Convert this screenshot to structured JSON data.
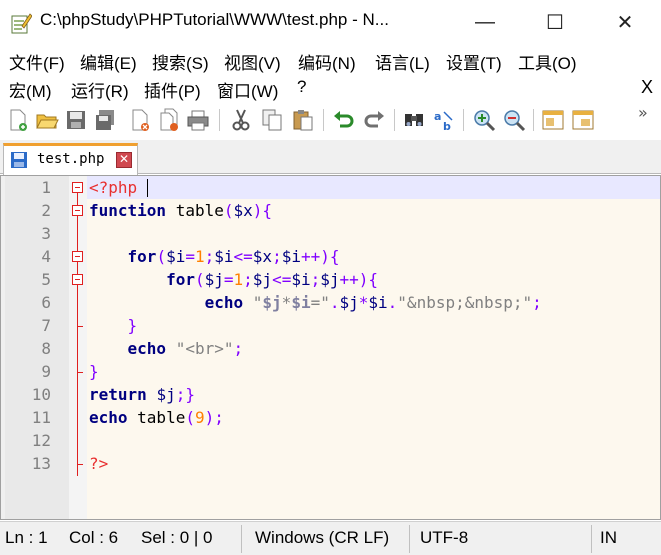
{
  "window": {
    "title": "C:\\phpStudy\\PHPTutorial\\WWW\\test.php - N...",
    "minimize": "—",
    "maximize": "☐",
    "close": "✕"
  },
  "menu": {
    "row1": [
      "文件(F)",
      "编辑(E)",
      "搜索(S)",
      "视图(V)",
      "编码(N)",
      "语言(L)",
      "设置(T)",
      "工具(O)"
    ],
    "row2": [
      "宏(M)",
      "运行(R)",
      "插件(P)",
      "窗口(W)",
      "?"
    ],
    "close_label": "X"
  },
  "toolbar": {
    "icons": [
      "new-file-icon",
      "open-file-icon",
      "save-icon",
      "save-all-icon",
      "close-icon",
      "close-all-icon",
      "print-icon",
      "cut-icon",
      "copy-icon",
      "paste-icon",
      "undo-icon",
      "redo-icon",
      "find-icon",
      "replace-icon",
      "zoom-in-icon",
      "zoom-out-icon",
      "sync-vertical-icon",
      "sync-horizontal-icon"
    ],
    "more": "»"
  },
  "tabs": [
    {
      "label": "test.php",
      "close": "✕",
      "active": true
    }
  ],
  "editor": {
    "line_numbers": [
      "1",
      "2",
      "3",
      "4",
      "5",
      "6",
      "7",
      "8",
      "9",
      "10",
      "11",
      "12",
      "13"
    ],
    "current_line": 1,
    "lines": [
      [
        {
          "t": "<?php",
          "c": "t-php"
        }
      ],
      [
        {
          "t": "function",
          "c": "t-kw"
        },
        {
          "t": " table",
          "c": "t-fn"
        },
        {
          "t": "(",
          "c": "t-op"
        },
        {
          "t": "$x",
          "c": "t-var"
        },
        {
          "t": "){",
          "c": "t-op"
        }
      ],
      [],
      [
        {
          "t": "    ",
          "c": ""
        },
        {
          "t": "for",
          "c": "t-kw"
        },
        {
          "t": "(",
          "c": "t-op"
        },
        {
          "t": "$i",
          "c": "t-var"
        },
        {
          "t": "=",
          "c": "t-op"
        },
        {
          "t": "1",
          "c": "t-num"
        },
        {
          "t": ";",
          "c": "t-op"
        },
        {
          "t": "$i",
          "c": "t-var"
        },
        {
          "t": "<=",
          "c": "t-op"
        },
        {
          "t": "$x",
          "c": "t-var"
        },
        {
          "t": ";",
          "c": "t-op"
        },
        {
          "t": "$i",
          "c": "t-var"
        },
        {
          "t": "++){",
          "c": "t-op"
        }
      ],
      [
        {
          "t": "        ",
          "c": ""
        },
        {
          "t": "for",
          "c": "t-kw"
        },
        {
          "t": "(",
          "c": "t-op"
        },
        {
          "t": "$j",
          "c": "t-var"
        },
        {
          "t": "=",
          "c": "t-op"
        },
        {
          "t": "1",
          "c": "t-num"
        },
        {
          "t": ";",
          "c": "t-op"
        },
        {
          "t": "$j",
          "c": "t-var"
        },
        {
          "t": "<=",
          "c": "t-op"
        },
        {
          "t": "$i",
          "c": "t-var"
        },
        {
          "t": ";",
          "c": "t-op"
        },
        {
          "t": "$j",
          "c": "t-var"
        },
        {
          "t": "++){",
          "c": "t-op"
        }
      ],
      [
        {
          "t": "            ",
          "c": ""
        },
        {
          "t": "echo",
          "c": "t-kw"
        },
        {
          "t": " ",
          "c": ""
        },
        {
          "t": "\"",
          "c": "t-str"
        },
        {
          "t": "$j",
          "c": "t-strb"
        },
        {
          "t": "*",
          "c": "t-str"
        },
        {
          "t": "$i",
          "c": "t-strb"
        },
        {
          "t": "=\"",
          "c": "t-str"
        },
        {
          "t": ".",
          "c": "t-op"
        },
        {
          "t": "$j",
          "c": "t-var"
        },
        {
          "t": "*",
          "c": "t-op"
        },
        {
          "t": "$i",
          "c": "t-var"
        },
        {
          "t": ".",
          "c": "t-op"
        },
        {
          "t": "\"&nbsp;&nbsp;\"",
          "c": "t-str"
        },
        {
          "t": ";",
          "c": "t-op"
        }
      ],
      [
        {
          "t": "    }",
          "c": "t-op"
        }
      ],
      [
        {
          "t": "    ",
          "c": ""
        },
        {
          "t": "echo",
          "c": "t-kw"
        },
        {
          "t": " ",
          "c": ""
        },
        {
          "t": "\"<br>\"",
          "c": "t-str"
        },
        {
          "t": ";",
          "c": "t-op"
        }
      ],
      [
        {
          "t": "}",
          "c": "t-op"
        }
      ],
      [
        {
          "t": "return",
          "c": "t-kw"
        },
        {
          "t": " ",
          "c": ""
        },
        {
          "t": "$j",
          "c": "t-var"
        },
        {
          "t": ";}",
          "c": "t-op"
        }
      ],
      [
        {
          "t": "echo",
          "c": "t-kw"
        },
        {
          "t": " table",
          "c": "t-fn"
        },
        {
          "t": "(",
          "c": "t-op"
        },
        {
          "t": "9",
          "c": "t-num"
        },
        {
          "t": ");",
          "c": "t-op"
        }
      ],
      [],
      [
        {
          "t": "?>",
          "c": "t-php"
        }
      ]
    ]
  },
  "status": {
    "ln": "Ln : 1",
    "col": "Col : 6",
    "sel": "Sel : 0 | 0",
    "eol": "Windows (CR LF)",
    "encoding": "UTF-8",
    "mode": "IN"
  }
}
